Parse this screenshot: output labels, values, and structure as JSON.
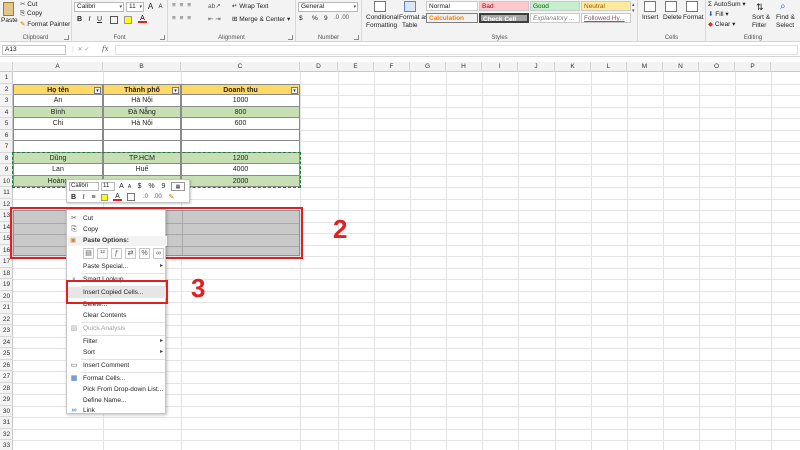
{
  "ribbon": {
    "clipboard": {
      "paste": "Paste",
      "cut": "Cut",
      "copy": "Copy",
      "format_painter": "Format Painter",
      "label": "Clipboard"
    },
    "font": {
      "name": "Calibri",
      "size": "11",
      "bold": "B",
      "italic": "I",
      "underline": "U",
      "grow": "A",
      "shrink": "A",
      "color_a": "A",
      "label": "Font"
    },
    "alignment": {
      "wrap": "Wrap Text",
      "merge": "Merge & Center",
      "label": "Alignment"
    },
    "number": {
      "format": "General",
      "currency": "$",
      "percent": "%",
      "comma": "9",
      "label": "Number"
    },
    "styles": {
      "conditional": "Conditional",
      "conditional2": "Formatting",
      "format_as": "Format as",
      "format_as2": "Table",
      "normal": "Normal",
      "bad": "Bad",
      "good": "Good",
      "neutral": "Neutral",
      "calculation": "Calculation",
      "check_cell": "Check Cell",
      "explanatory": "Explanatory ...",
      "followed": "Followed Hy...",
      "label": "Styles"
    },
    "cells": {
      "insert": "Insert",
      "delete": "Delete",
      "format": "Format",
      "label": "Cells"
    },
    "editing": {
      "autosum": "AutoSum",
      "fill": "Fill",
      "clear": "Clear",
      "sort": "Sort &",
      "sort2": "Filter",
      "find": "Find &",
      "find2": "Select",
      "label": "Editing"
    },
    "colors": {
      "bad": "#ffc7ce",
      "good": "#c6efce",
      "neutral": "#ffeb9c",
      "calc_border": "#f4b084",
      "check_bg": "#a5a5a5"
    }
  },
  "formula_bar": {
    "name_box": "A13",
    "fx": "fx",
    "value": ""
  },
  "columns": [
    "A",
    "B",
    "C",
    "D",
    "E",
    "F",
    "G",
    "H",
    "I",
    "J",
    "K",
    "L",
    "M",
    "N",
    "O",
    "P"
  ],
  "rows": [
    "1",
    "2",
    "3",
    "4",
    "5",
    "6",
    "7",
    "8",
    "9",
    "10",
    "11",
    "12",
    "13",
    "14",
    "15",
    "16",
    "17",
    "18",
    "19",
    "20",
    "21",
    "22",
    "23",
    "24",
    "25",
    "26",
    "27",
    "28",
    "29",
    "30",
    "31",
    "32",
    "33"
  ],
  "table": {
    "headers": [
      "Họ tên",
      "Thành phố",
      "Doanh thu"
    ],
    "rows_top": [
      [
        "An",
        "Hà Nội",
        "1000"
      ],
      [
        "Bình",
        "Đà Nẵng",
        "800"
      ],
      [
        "Chi",
        "Hà Nội",
        "600"
      ]
    ],
    "rows_bottom": [
      [
        "Dũng",
        "TP.HCM",
        "1200"
      ],
      [
        "Lan",
        "Huế",
        "4000"
      ],
      [
        "Hoàng",
        "",
        "2000"
      ]
    ]
  },
  "mini_toolbar": {
    "font": "Calibri",
    "size": "11",
    "currency": "$",
    "percent": "%",
    "comma": "9",
    "bold": "B",
    "italic": "I",
    "align": "≡",
    "color_a": "A"
  },
  "context_menu": {
    "cut": "Cut",
    "copy": "Copy",
    "paste_options": "Paste Options:",
    "paste_special": "Paste Special...",
    "smart_lookup": "Smart Lookup",
    "insert_copied": "Insert Copied Cells...",
    "delete": "Delete...",
    "clear_contents": "Clear Contents",
    "quick_analysis": "Quick Analysis",
    "filter": "Filter",
    "sort": "Sort",
    "insert_comment": "Insert Comment",
    "format_cells": "Format Cells...",
    "pick_list": "Pick From Drop-down List...",
    "define_name": "Define Name...",
    "link": "Link"
  },
  "callouts": {
    "two": "2",
    "three": "3"
  }
}
